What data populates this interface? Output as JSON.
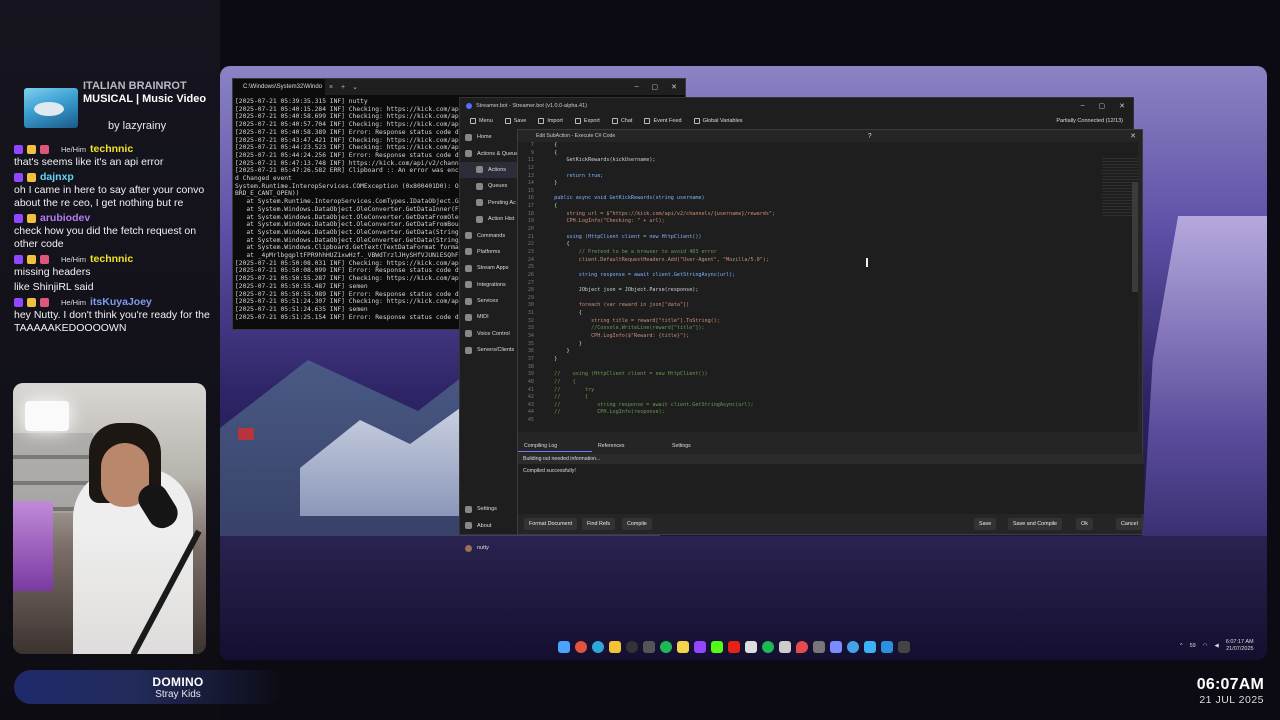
{
  "music": {
    "title_line1": "ITALIAN BRAINROT",
    "title_line2": "MUSICAL | Music Video",
    "artist": "by lazyrainy"
  },
  "chat": [
    {
      "pronoun": "He/Him",
      "user": "technnic",
      "user_color": "#f4e22a",
      "message": "that's seems like it's an api error"
    },
    {
      "pronoun": "",
      "user": "dajnxp",
      "user_color": "#5fd6f3",
      "message": "oh I came in here to say after your convo about the re ceo, I get nothing but re"
    },
    {
      "pronoun": "",
      "user": "arubiodev",
      "user_color": "#b47cf2",
      "message": "check how you did the fetch request on other code"
    },
    {
      "pronoun": "He/Him",
      "user": "technnic",
      "user_color": "#f4e22a",
      "message": "missing headers"
    },
    {
      "pronoun": "",
      "user": "",
      "user_color": "#f4e22a",
      "message": "like ShinjiRL said"
    },
    {
      "pronoun": "He/Him",
      "user": "itsKuyaJoey",
      "user_color": "#7d9cf0",
      "message": "hey Nutty. I don't think you're ready for the TAAAAAKEDOOOOWN"
    }
  ],
  "now_playing": {
    "title": "DOMINO",
    "artist": "Stray Kids"
  },
  "clock": {
    "time": "06:07AM",
    "date": "21 JUL 2025"
  },
  "terminal": {
    "tab_title": "C:\\Windows\\System32\\Windo",
    "lines": [
      "[2025-07-21 05:39:35.315 INF] nutty",
      "[2025-07-21 05:40:15.284 INF] Checking: https://kick.com/api/",
      "[2025-07-21 05:40:58.699 INF] Checking: https://kick.com/api/",
      "[2025-07-21 05:40:57.704 INF] Checking: https://kick.com/api/",
      "[2025-07-21 05:40:58.389 INF] Error: Response status code doe",
      "[2025-07-21 05:43:47.421 INF] Checking: https://kick.com/api/",
      "[2025-07-21 05:44:23.523 INF] Checking: https://kick.com/api/",
      "[2025-07-21 05:44:24.256 INF] Error: Response status code doe",
      "[2025-07-21 05:47:13.748 INF] https://kick.com/api/v2/channel",
      "[2025-07-21 05:47:26.582 ERR] Clipboard :: An error was encou",
      "d Changed event",
      "System.Runtime.InteropServices.COMException (0x800401D0): Ope",
      "BRD_E_CANT_OPEN))",
      "   at System.Runtime.InteropServices.ComTypes.IDataObject.Get",
      "   at System.Windows.DataObject.OleConverter.GetDataInner(FOR",
      "   at System.Windows.DataObject.OleConverter.GetDataFromOleHG",
      "   at System.Windows.DataObject.OleConverter.GetDataFromBound",
      "   at System.Windows.DataObject.OleConverter.GetData(String f",
      "   at System.Windows.DataObject.OleConverter.GetData(String f",
      "   at System.Windows.Clipboard.GetText(TextDataFormat format)",
      "   at _4pMrlbgqpltFPR9hhHUZ1xwHzf._VBWdTrzlJHySHfVJUNiESQhFf",
      "[2025-07-21 05:50:08.031 INF] Checking: https://kick.com/api/",
      "[2025-07-21 05:50:08.099 INF] Error: Response status code doe",
      "[2025-07-21 05:50:55.287 INF] Checking: https://kick.com/api/",
      "[2025-07-21 05:50:55.487 INF] semen",
      "[2025-07-21 05:50:55.989 INF] Error: Response status code doe",
      "[2025-07-21 05:51:24.307 INF] Checking: https://kick.com/api/",
      "[2025-07-21 05:51:24.635 INF] semen",
      "[2025-07-21 05:51:25.154 INF] Error: Response status code doe"
    ]
  },
  "streamerbot": {
    "title": "Streamer.bot - Streamer.bot (v1.0.0-alpha.41)",
    "menu": [
      "Menu",
      "Save",
      "Import",
      "Export",
      "Chat",
      "Event Feed",
      "Global Variables"
    ],
    "connection": "Partially Connected (12/13)",
    "nav": [
      {
        "label": "Home",
        "sub": false,
        "sel": false
      },
      {
        "label": "Actions & Queues",
        "sub": false,
        "sel": false
      },
      {
        "label": "Actions",
        "sub": true,
        "sel": true
      },
      {
        "label": "Queues",
        "sub": true,
        "sel": false
      },
      {
        "label": "Pending Ac",
        "sub": true,
        "sel": false
      },
      {
        "label": "Action Hist",
        "sub": true,
        "sel": false
      },
      {
        "label": "Commands",
        "sub": false,
        "sel": false
      },
      {
        "label": "Platforms",
        "sub": false,
        "sel": false
      },
      {
        "label": "Stream Apps",
        "sub": false,
        "sel": false
      },
      {
        "label": "Integrations",
        "sub": false,
        "sel": false
      },
      {
        "label": "Services",
        "sub": false,
        "sel": false
      },
      {
        "label": "MIDI",
        "sub": false,
        "sel": false
      },
      {
        "label": "Voice Control",
        "sub": false,
        "sel": false
      },
      {
        "label": "Servers/Clients",
        "sub": false,
        "sel": false
      }
    ],
    "nav_bottom": [
      "Settings",
      "About"
    ],
    "user": "nutty"
  },
  "editor": {
    "title": "Edit SubAction - Execute C# Code",
    "lines": [
      {
        "n": "7",
        "t": "    {"
      },
      {
        "n": "9",
        "t": "    {"
      },
      {
        "n": "11",
        "t": "        GetKickRewards(kickUsername);"
      },
      {
        "n": "12",
        "t": ""
      },
      {
        "n": "13",
        "t": "        return true;"
      },
      {
        "n": "14",
        "t": "    }"
      },
      {
        "n": "15",
        "t": ""
      },
      {
        "n": "16",
        "t": "    public async void GetKickRewards(string username)"
      },
      {
        "n": "17",
        "t": "    {"
      },
      {
        "n": "18",
        "t": "        string url = $\"https://kick.com/api/v2/channels/{username}/rewards\";"
      },
      {
        "n": "19",
        "t": "        CPH.LogInfo(\"Checking: \" + url);"
      },
      {
        "n": "20",
        "t": ""
      },
      {
        "n": "21",
        "t": "        using (HttpClient client = new HttpClient())"
      },
      {
        "n": "22",
        "t": "        {"
      },
      {
        "n": "23",
        "t": "            // Pretend to be a browser to avoid 403 error"
      },
      {
        "n": "24",
        "t": "            client.DefaultRequestHeaders.Add(\"User-Agent\", \"Mozilla/5.0\");"
      },
      {
        "n": "25",
        "t": ""
      },
      {
        "n": "26",
        "t": "            string response = await client.GetStringAsync(url);"
      },
      {
        "n": "27",
        "t": ""
      },
      {
        "n": "28",
        "t": "            JObject json = JObject.Parse(response);"
      },
      {
        "n": "29",
        "t": ""
      },
      {
        "n": "30",
        "t": "            foreach (var reward in json[\"data\"])"
      },
      {
        "n": "31",
        "t": "            {"
      },
      {
        "n": "32",
        "t": "                string title = reward[\"title\"].ToString();"
      },
      {
        "n": "33",
        "t": "                //Console.WriteLine(reward[\"title\"]);"
      },
      {
        "n": "34",
        "t": "                CPH.LogInfo($\"Reward: {title}\");"
      },
      {
        "n": "35",
        "t": "            }"
      },
      {
        "n": "36",
        "t": "        }"
      },
      {
        "n": "37",
        "t": "    }"
      },
      {
        "n": "38",
        "t": ""
      },
      {
        "n": "39",
        "t": "    //    using (HttpClient client = new HttpClient())"
      },
      {
        "n": "40",
        "t": "    //    {"
      },
      {
        "n": "41",
        "t": "    //        try"
      },
      {
        "n": "42",
        "t": "    //        {"
      },
      {
        "n": "43",
        "t": "    //            string response = await client.GetStringAsync(url);"
      },
      {
        "n": "44",
        "t": "    //            CPH.LogInfo(response);"
      },
      {
        "n": "45",
        "t": ""
      }
    ],
    "bottom_tabs": [
      "Compiling Log",
      "References",
      "Settings"
    ],
    "log_status": "Building out needed information...",
    "log_result": "Compiled successfully!",
    "buttons_left": [
      "Format Document",
      "Find Refs",
      "Compile"
    ],
    "buttons_right": [
      "Save",
      "Save and Compile",
      "Ok",
      "Cancel"
    ]
  },
  "taskbar": {
    "tray_count": "59",
    "time": "6:07:17 AM",
    "date": "21/07/2025"
  }
}
